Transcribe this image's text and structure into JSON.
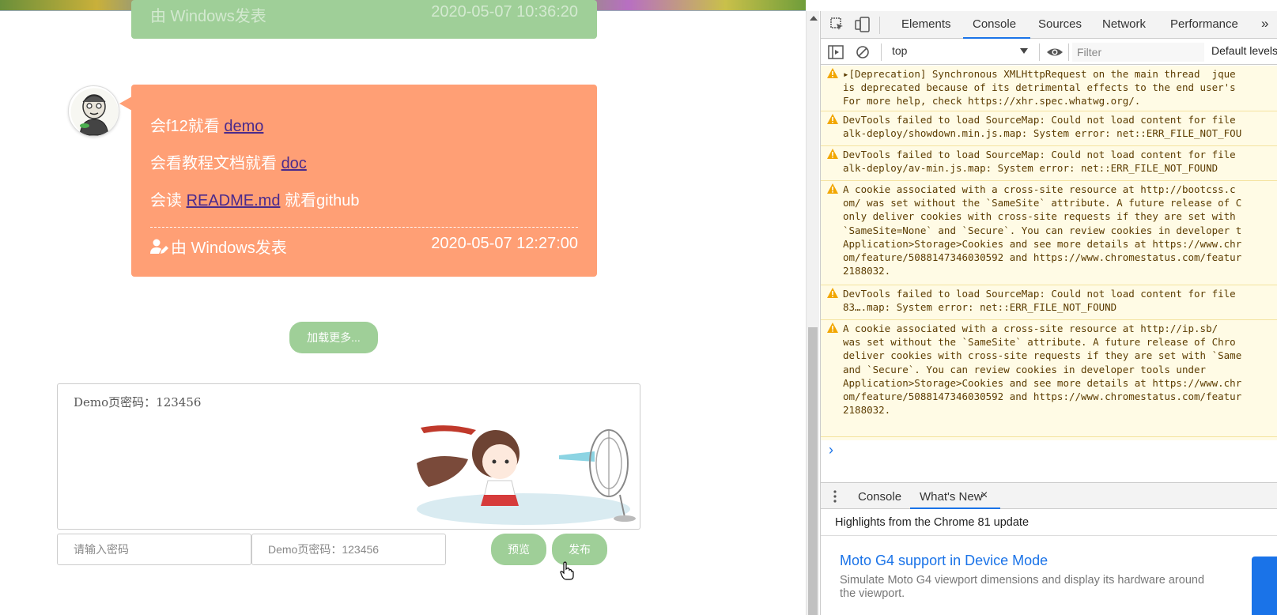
{
  "page": {
    "prev_card": {
      "author": "由 Windows发表",
      "date": "2020-05-07 10:36:20"
    },
    "post": {
      "line1_text": "会f12就看 ",
      "line1_link": "demo",
      "line2_text": "会看教程文档就看 ",
      "line2_link": "doc",
      "line3_prefix": "会读 ",
      "line3_link": "README.md",
      "line3_suffix": " 就看github",
      "author": "由 Windows发表",
      "date": "2020-05-07 12:27:00"
    },
    "load_more": "加载更多...",
    "editor_text": "Demo页密码：123456",
    "password_placeholder": "请输入密码",
    "demo_password_value": "Demo页密码：123456",
    "preview_button": "预览",
    "publish_button": "发布",
    "accent_green": "#9fcf98",
    "accent_orange": "#ff9f75"
  },
  "devtools": {
    "tabs": [
      "Elements",
      "Console",
      "Sources",
      "Network",
      "Performance"
    ],
    "active_tab": "Console",
    "more_tabs": "»",
    "context": "top",
    "filter_placeholder": "Filter",
    "levels": "Default levels",
    "messages": [
      {
        "lines": [
          "[Deprecation] Synchronous XMLHttpRequest on the main thread  jque",
          "is deprecated because of its detrimental effects to the end user's",
          "For more help, check https://xhr.spec.whatwg.org/."
        ]
      },
      {
        "lines": [
          "DevTools failed to load SourceMap: Could not load content for file",
          "alk-deploy/showdown.min.js.map: System error: net::ERR_FILE_NOT_FOU"
        ]
      },
      {
        "lines": [
          "DevTools failed to load SourceMap: Could not load content for file",
          "alk-deploy/av-min.js.map: System error: net::ERR_FILE_NOT_FOUND"
        ]
      },
      {
        "lines": [
          "A cookie associated with a cross-site resource at http://bootcss.c",
          "om/ was set without the `SameSite` attribute. A future release of C",
          "only deliver cookies with cross-site requests if they are set with",
          "`SameSite=None` and `Secure`. You can review cookies in developer t",
          "Application>Storage>Cookies and see more details at https://www.chr",
          "om/feature/5088147346030592 and https://www.chromestatus.com/featur",
          "2188032."
        ]
      },
      {
        "lines": [
          "DevTools failed to load SourceMap: Could not load content for file",
          "83….map: System error: net::ERR_FILE_NOT_FOUND"
        ]
      },
      {
        "lines": [
          "A cookie associated with a cross-site resource at http://ip.sb/",
          "was set without the `SameSite` attribute. A future release of Chro",
          "deliver cookies with cross-site requests if they are set with `Same",
          "and `Secure`. You can review cookies in developer tools under",
          "Application>Storage>Cookies and see more details at https://www.chr",
          "om/feature/5088147346030592 and https://www.chromestatus.com/featur",
          "2188032."
        ]
      }
    ],
    "prompt": "›",
    "drawer": {
      "tabs": [
        "Console",
        "What's New"
      ],
      "active": "What's New",
      "close": "×",
      "highlight": "Highlights from the Chrome 81 update",
      "feature_title": "Moto G4 support in Device Mode",
      "feature_desc": "Simulate Moto G4 viewport dimensions and display its hardware around the viewport."
    },
    "warn_color": "#f2a600",
    "link_blue": "#1a73e8"
  }
}
